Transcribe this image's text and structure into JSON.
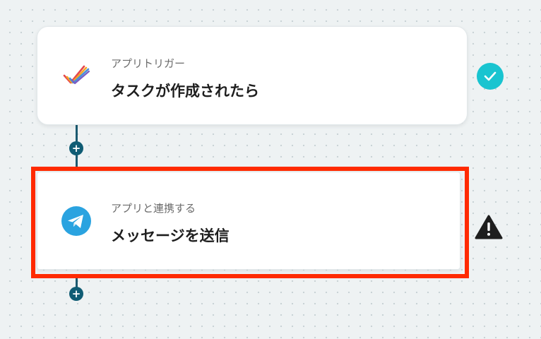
{
  "flow": {
    "steps": [
      {
        "subtitle": "アプリトリガー",
        "title": "タスクが作成されたら",
        "icon": "todoist-checkmark-logo-icon",
        "status": "completed-check-icon"
      },
      {
        "subtitle": "アプリと連携する",
        "title": "メッセージを送信",
        "icon": "telegram-logo-icon",
        "status": "warning-icon"
      }
    ],
    "add_step_label": "+"
  },
  "colors": {
    "connector": "#1b5a70",
    "add_dot": "#0f5c74",
    "check_badge": "#19c4d0",
    "highlight_frame": "#ff2a00",
    "telegram_blue": "#2aa3e0",
    "warning": "#1e1e1e"
  }
}
